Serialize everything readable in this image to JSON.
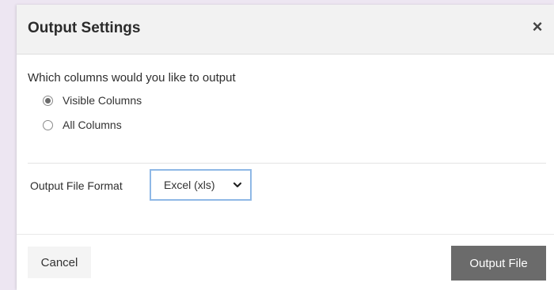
{
  "dialog": {
    "title": "Output Settings",
    "close_glyph": "×"
  },
  "columns": {
    "question": "Which columns would you like to output",
    "options": [
      {
        "label": "Visible Columns",
        "checked": true
      },
      {
        "label": "All Columns",
        "checked": false
      }
    ]
  },
  "format": {
    "label": "Output File Format",
    "selected": "Excel (xls)",
    "icon": "chevron-down-icon"
  },
  "footer": {
    "cancel_label": "Cancel",
    "output_label": "Output File"
  },
  "colors": {
    "primary_button": "#6b6b6b",
    "select_focus_border": "#8fb8e6",
    "header_bg": "#f2f2f2"
  }
}
